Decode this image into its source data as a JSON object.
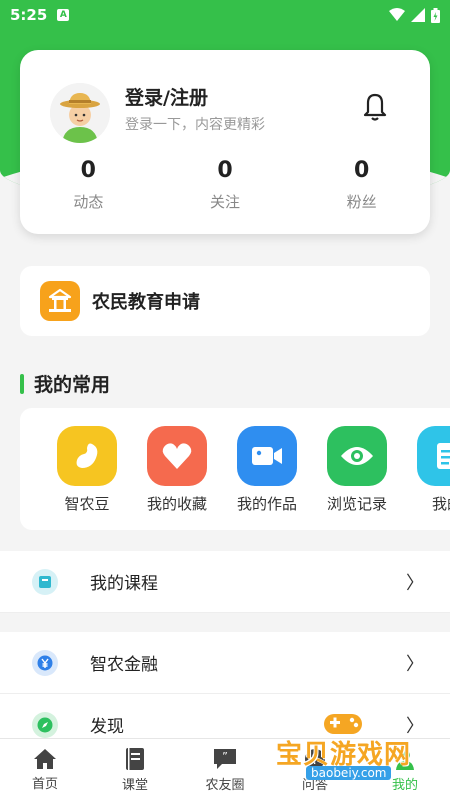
{
  "status": {
    "time": "5:25",
    "indicator": "A"
  },
  "profile": {
    "title": "登录/注册",
    "subtitle": "登录一下，内容更精彩",
    "stats": [
      {
        "value": "0",
        "label": "动态"
      },
      {
        "value": "0",
        "label": "关注"
      },
      {
        "value": "0",
        "label": "粉丝"
      }
    ]
  },
  "education": {
    "label": "农民教育申请"
  },
  "favorites": {
    "title": "我的常用",
    "items": [
      {
        "label": "智农豆",
        "icon": "bean-icon",
        "color": "#f6c521"
      },
      {
        "label": "我的收藏",
        "icon": "heart-icon",
        "color": "#f56a4e"
      },
      {
        "label": "我的作品",
        "icon": "video-camera-icon",
        "color": "#2f8ef0"
      },
      {
        "label": "浏览记录",
        "icon": "eye-icon",
        "color": "#2dc05f"
      },
      {
        "label": "我的",
        "icon": "document-icon",
        "color": "#2fc4e8"
      }
    ]
  },
  "menu": {
    "courses": {
      "label": "我的课程",
      "chevron": "〉"
    },
    "finance": {
      "label": "智农金融",
      "chevron": "〉"
    },
    "discover": {
      "label": "发现",
      "chevron": "〉"
    }
  },
  "nav": {
    "items": [
      {
        "label": "首页",
        "icon": "home-icon"
      },
      {
        "label": "课堂",
        "icon": "book-icon"
      },
      {
        "label": "农友圈",
        "icon": "chat-icon"
      },
      {
        "label": "问答",
        "icon": "question-icon"
      },
      {
        "label": "我的",
        "icon": "user-icon"
      }
    ]
  },
  "watermark": {
    "text": "宝贝游戏网",
    "url": "baobeiy.com"
  },
  "colors": {
    "accent": "#35c04a",
    "background": "#f4f4f4"
  }
}
